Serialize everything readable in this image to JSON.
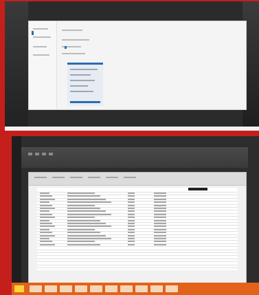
{
  "top_photo": {
    "window": {
      "nav_items": [
        "",
        "",
        "",
        "",
        ""
      ],
      "panel_rows": 6
    },
    "caption": ""
  },
  "bottom_photo": {
    "ribbon_tabs": [
      "",
      "",
      "",
      "",
      "",
      ""
    ],
    "sheet_rows": 26,
    "taskbar_items": [
      "",
      "",
      "",
      "",
      "",
      "",
      "",
      "",
      "",
      ""
    ]
  }
}
